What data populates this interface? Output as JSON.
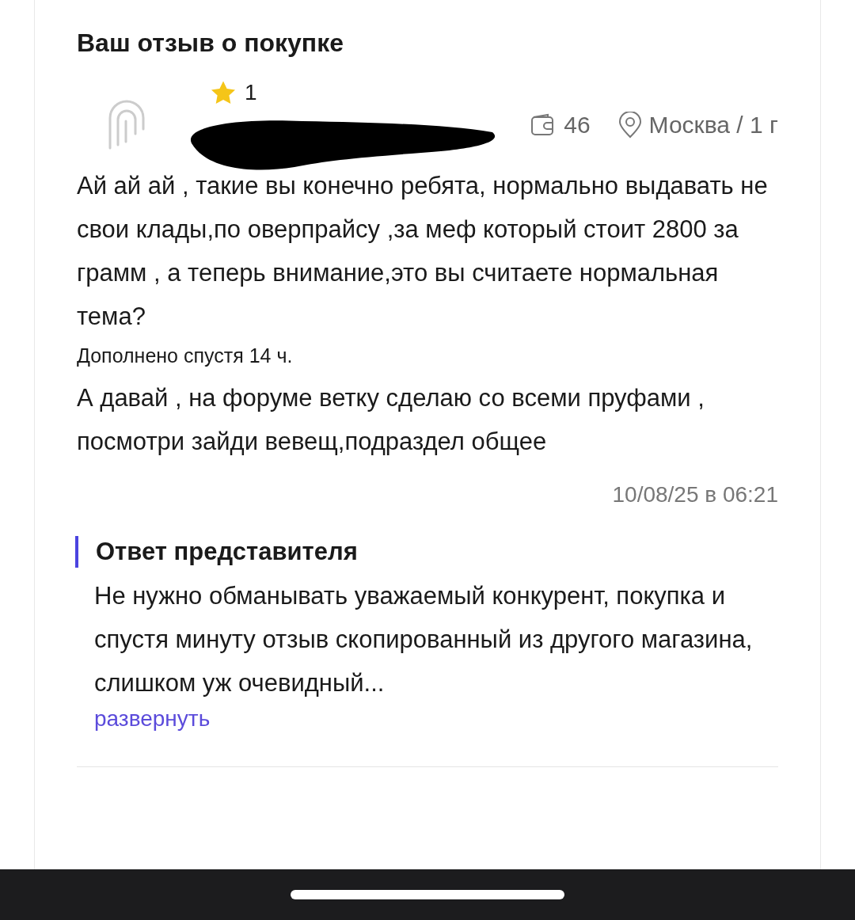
{
  "title": "Ваш отзыв о покупке",
  "review": {
    "rating": "1",
    "purchases": "46",
    "location": "Москва / 1 г",
    "text": "Ай ай ай , такие вы конечно ребята, нормально выдавать не свои клады,по оверпрайсу ,за меф который стоит 2800 за грамм , а теперь внимание,это вы считаете нормальная тема?",
    "addendum_label": "Дополнено спустя 14 ч.",
    "addendum": "А давай , на форуме ветку сделаю со всеми пруфами , посмотри зайди вевещ,подраздел общее",
    "date": "10/08/25 в 06:21"
  },
  "reply": {
    "title": "Ответ представителя",
    "text": "Не нужно обманывать уважаемый конкурент, покупка и спустя минуту отзыв скопированный из другого магазина, слишком уж очевидный...",
    "expand_link": "развернуть"
  }
}
